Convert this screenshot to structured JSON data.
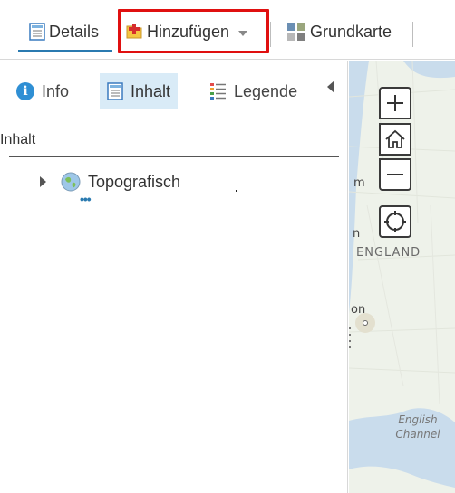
{
  "toolbar": {
    "details_label": "Details",
    "add_label": "Hinzufügen",
    "basemap_label": "Grundkarte"
  },
  "panel": {
    "tabs": [
      {
        "label": "Info",
        "icon": "info-icon"
      },
      {
        "label": "Inhalt",
        "icon": "document-icon"
      },
      {
        "label": "Legende",
        "icon": "legend-icon"
      }
    ],
    "active_tab": "Inhalt",
    "section_title": "Inhalt",
    "layers": [
      {
        "name": "Topografisch",
        "icon": "globe-icon",
        "more": "•••"
      }
    ]
  },
  "map": {
    "labels": {
      "m": "m",
      "n": "n",
      "england": "ENGLAND",
      "on": "on",
      "channel_line1": "English",
      "channel_line2": "Channel"
    }
  },
  "colors": {
    "accent": "#2a7ab0",
    "highlight": "#e01010",
    "active_tab_bg": "#d9ebf7",
    "map_land": "#eef2ea",
    "map_water": "#c9dcec"
  }
}
